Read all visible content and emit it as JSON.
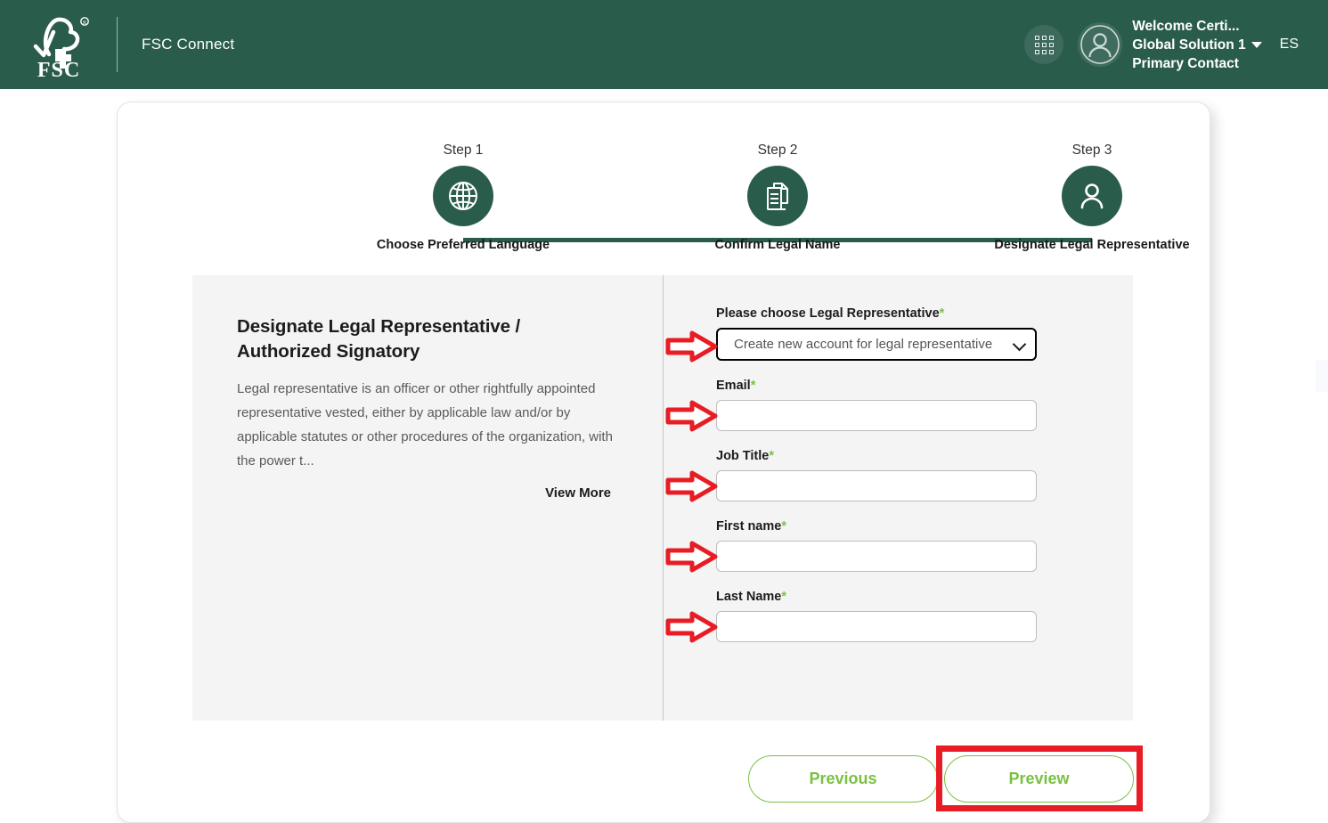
{
  "header": {
    "logo_alt": "FSC",
    "logo_mark": "fsc-tree-checkmark-logo",
    "app_title": "FSC Connect",
    "apps_icon": "grid-apps-icon",
    "avatar_icon": "user-avatar-icon",
    "user": {
      "line1": "Welcome Certi...",
      "line2": "Global Solution 1",
      "line3": "Primary Contact",
      "caret_icon": "chevron-down-icon"
    },
    "language": "ES",
    "bg_color": "#2a5c4c"
  },
  "stepper": {
    "steps": [
      {
        "number": "Step 1",
        "label": "Choose Preferred Language",
        "icon": "globe-icon"
      },
      {
        "number": "Step 2",
        "label": "Confirm Legal Name",
        "icon": "documents-icon"
      },
      {
        "number": "Step 3",
        "label": "Designate Legal Representative",
        "icon": "person-icon"
      }
    ],
    "active_color": "#2a5c4c"
  },
  "info": {
    "title": "Designate Legal Representative / Authorized Signatory",
    "description": "Legal representative is an officer or other rightfully appointed representative vested, either by applicable law and/or by applicable statutes or other procedures of the organization, with the power t...",
    "view_more": "View More"
  },
  "form": {
    "required_marker": "*",
    "required_color": "#7ac143",
    "select": {
      "label": "Please choose Legal Representative",
      "value": "Create new account for legal representative",
      "chevron_icon": "chevron-down-icon"
    },
    "fields": [
      {
        "label": "Email",
        "value": "",
        "placeholder": ""
      },
      {
        "label": "Job Title",
        "value": "",
        "placeholder": ""
      },
      {
        "label": "First name",
        "value": "",
        "placeholder": ""
      },
      {
        "label": "Last Name",
        "value": "",
        "placeholder": ""
      }
    ]
  },
  "footer": {
    "previous_label": "Previous",
    "preview_label": "Preview",
    "button_color": "#7ac143",
    "highlight_color": "#e81c24"
  },
  "annotations": {
    "arrow_color": "#e81c24",
    "arrow_count": 5,
    "highlight_target": "Preview"
  }
}
